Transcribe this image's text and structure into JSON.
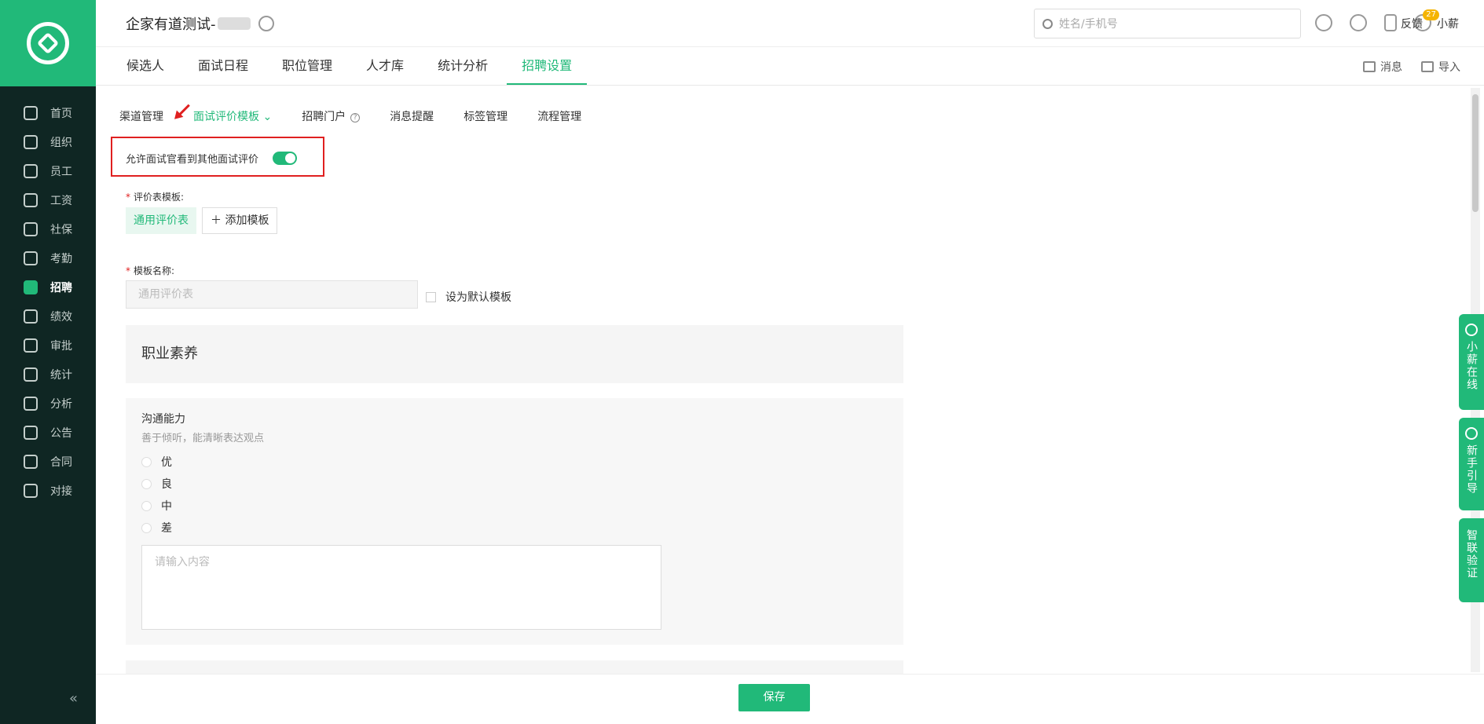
{
  "sidebar": {
    "items": [
      {
        "label": "首页",
        "icon": "home-icon"
      },
      {
        "label": "组织",
        "icon": "org-icon"
      },
      {
        "label": "员工",
        "icon": "employee-icon"
      },
      {
        "label": "工资",
        "icon": "salary-icon"
      },
      {
        "label": "社保",
        "icon": "shield-icon"
      },
      {
        "label": "考勤",
        "icon": "attendance-icon"
      },
      {
        "label": "招聘",
        "icon": "recruit-icon",
        "active": true
      },
      {
        "label": "绩效",
        "icon": "performance-icon"
      },
      {
        "label": "审批",
        "icon": "approval-icon"
      },
      {
        "label": "统计",
        "icon": "pie-icon"
      },
      {
        "label": "分析",
        "icon": "analysis-icon"
      },
      {
        "label": "公告",
        "icon": "notice-icon"
      },
      {
        "label": "合同",
        "icon": "contract-icon"
      },
      {
        "label": "对接",
        "icon": "connect-icon"
      }
    ],
    "collapse": "«"
  },
  "header": {
    "company": "企家有道测试-",
    "search_placeholder": "姓名/手机号",
    "notification_count": "27",
    "feedback": "反馈",
    "user": "小薪"
  },
  "tabs": {
    "items": [
      "候选人",
      "面试日程",
      "职位管理",
      "人才库",
      "统计分析",
      "招聘设置"
    ],
    "active_index": 5,
    "message": "消息",
    "import": "导入"
  },
  "subtabs": {
    "channel": "渠道管理",
    "template": "面试评价模板",
    "portal": "招聘门户",
    "reminder": "消息提醒",
    "tags": "标签管理",
    "process": "流程管理"
  },
  "form": {
    "toggle_label": "允许面试官看到其他面试评价",
    "toggle_on": true,
    "eval_template_label": "评价表模板:",
    "current_template": "通用评价表",
    "add_template": "添加模板",
    "template_name_label": "模板名称:",
    "template_name_value": "通用评价表",
    "set_default": "设为默认模板",
    "section_title": "职业素养",
    "item_title": "沟通能力",
    "item_desc": "善于倾听，能清晰表达观点",
    "options": [
      "优",
      "良",
      "中",
      "差"
    ],
    "comment_placeholder": "请输入内容"
  },
  "floating": {
    "online": "小薪在线",
    "guide": "新手引导",
    "verify": "智联验证"
  },
  "footer": {
    "save": "保存"
  },
  "colors": {
    "brand": "#21b979",
    "sidebar_bg": "#0f2623",
    "highlight": "#e02020"
  }
}
